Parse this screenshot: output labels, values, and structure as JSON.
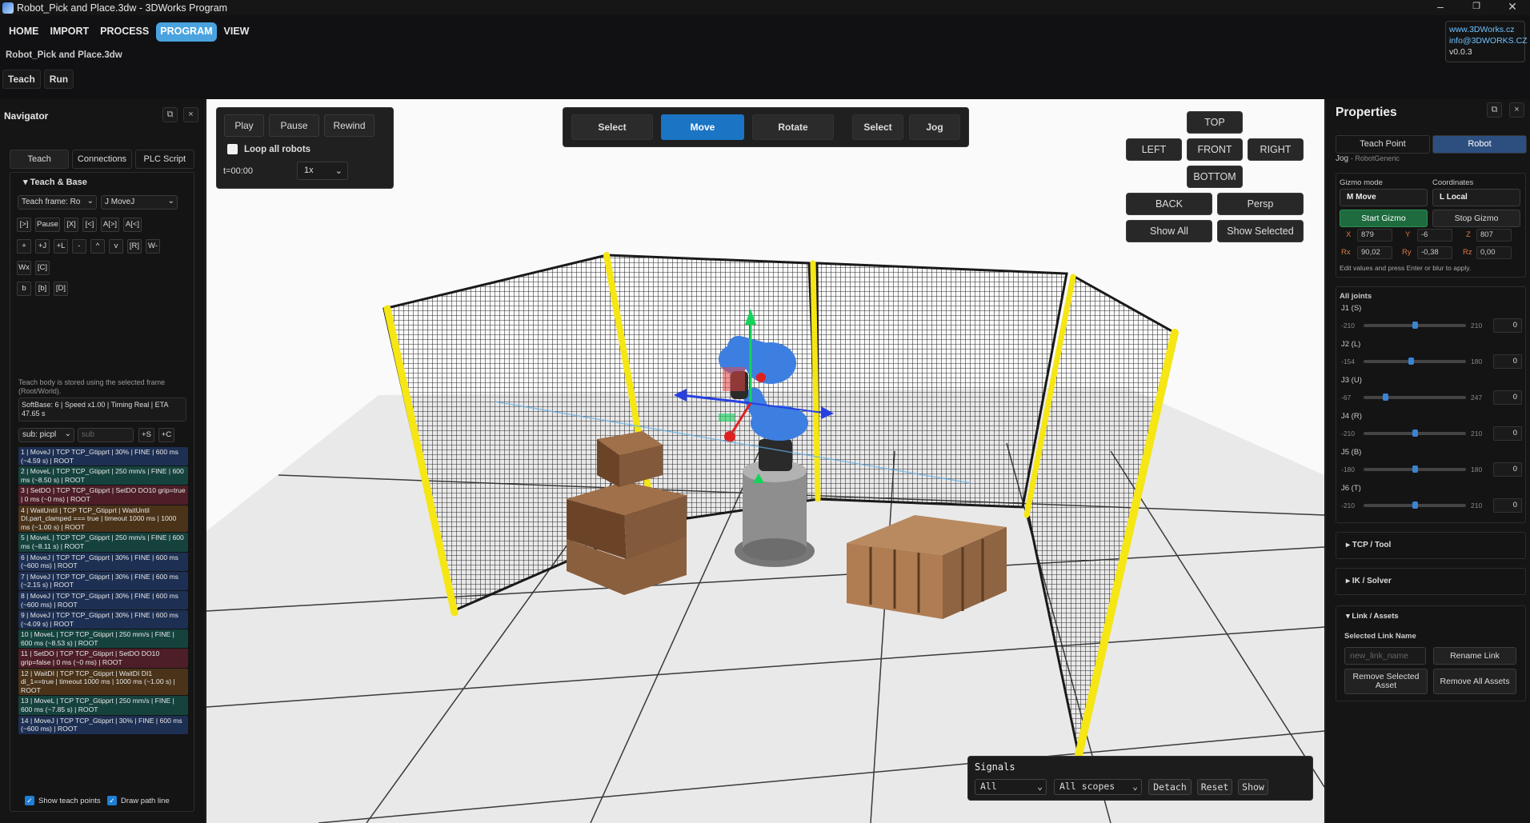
{
  "window": {
    "title": "Robot_Pick and Place.3dw - 3DWorks Program",
    "minimize": "–",
    "maximize": "❐",
    "close": "✕"
  },
  "menu": {
    "items": [
      "HOME",
      "IMPORT",
      "PROCESS",
      "PROGRAM",
      "VIEW"
    ],
    "active": "PROGRAM"
  },
  "file": {
    "name": "Robot_Pick and Place.3dw"
  },
  "modes": {
    "teach": "Teach",
    "run": "Run"
  },
  "about": {
    "site": "www.3DWorks.cz",
    "email": "info@3DWORKS.CZ",
    "version": "v0.0.3"
  },
  "navigator": {
    "title": "Navigator",
    "detach": "⧉",
    "close": "×",
    "tabs": [
      "Teach",
      "Connections",
      "PLC Script"
    ],
    "section": "▾  Teach & Base",
    "teach_frame": "Teach frame: Ro",
    "move_type": "J MoveJ",
    "tool_row1": [
      "[>]",
      "Pause",
      "[X]",
      "[<]",
      "A[>]",
      "A[<]"
    ],
    "tool_row2": [
      "+",
      "+J",
      "+L",
      "-",
      "^",
      "v",
      "[R]",
      "W-"
    ],
    "tool_row3": [
      "Wx",
      "[C]"
    ],
    "tool_row4": [
      "b",
      "[b]",
      "[D]"
    ],
    "note": "Teach body is stored using the selected frame (Root/World).",
    "info": "SoftBase: 6 | Speed x1.00 | Timing Real | ETA 47.65 s",
    "sub_select": "sub: picpl",
    "sub_placeholder": "sub",
    "add_s": "+S",
    "add_c": "+C",
    "steps": [
      {
        "text": "1 | MoveJ | TCP TCP_Gtipprt | 30% | FINE | 600 ms (~4.59 s) | ROOT",
        "kind": "movej"
      },
      {
        "text": "2 | MoveL | TCP TCP_Gtipprt | 250 mm/s | FINE | 600 ms (~8.50 s) | ROOT",
        "kind": "movel"
      },
      {
        "text": "3 | SetDO | TCP TCP_Gtipprt | SetDO DO10 grip=true | 0 ms (~0 ms) | ROOT",
        "kind": "setdo"
      },
      {
        "text": "4 | WaitUntil | TCP TCP_Gtipprt | WaitUntil DI.part_clamped === true | timeout 1000 ms | 1000 ms (~1.00 s) | ROOT",
        "kind": "wait"
      },
      {
        "text": "5 | MoveL | TCP TCP_Gtipprt | 250 mm/s | FINE | 600 ms (~8.11 s) | ROOT",
        "kind": "movel"
      },
      {
        "text": "6 | MoveJ | TCP TCP_Gtipprt | 30% | FINE | 600 ms (~600 ms) | ROOT",
        "kind": "movej"
      },
      {
        "text": "7 | MoveJ | TCP TCP_Gtipprt | 30% | FINE | 600 ms (~2.15 s) | ROOT",
        "kind": "movej"
      },
      {
        "text": "8 | MoveJ | TCP TCP_Gtipprt | 30% | FINE | 600 ms (~600 ms) | ROOT",
        "kind": "movej"
      },
      {
        "text": "9 | MoveJ | TCP TCP_Gtipprt | 30% | FINE | 600 ms (~4.09 s) | ROOT",
        "kind": "movej"
      },
      {
        "text": "10 | MoveL | TCP TCP_Gtipprt | 250 mm/s | FINE | 600 ms (~8.53 s) | ROOT",
        "kind": "movel"
      },
      {
        "text": "11 | SetDO | TCP TCP_Gtipprt | SetDO DO10 grip=false | 0 ms (~0 ms) | ROOT",
        "kind": "setdo"
      },
      {
        "text": "12 | WaitDI | TCP TCP_Gtipprt | WaitDI DI1 di_1==true | timeout 1000 ms | 1000 ms (~1.00 s) | ROOT",
        "kind": "wait"
      },
      {
        "text": "13 | MoveL | TCP TCP_Gtipprt | 250 mm/s | FINE | 600 ms (~7.85 s) | ROOT",
        "kind": "movel"
      },
      {
        "text": "14 | MoveJ | TCP TCP_Gtipprt | 30% | FINE | 600 ms (~600 ms) | ROOT",
        "kind": "movej"
      }
    ],
    "show_points": "Show teach points",
    "draw_path": "Draw path line"
  },
  "playback": {
    "play": "Play",
    "pause": "Pause",
    "rewind": "Rewind",
    "loop": "Loop all robots",
    "time": "t=00:00",
    "speed": "1x"
  },
  "tools": {
    "select": "Select",
    "move": "Move",
    "rotate": "Rotate",
    "select2": "Select",
    "jog": "Jog",
    "active": "Move"
  },
  "views": {
    "top": "TOP",
    "left": "LEFT",
    "front": "FRONT",
    "right": "RIGHT",
    "bottom": "BOTTOM",
    "back": "BACK",
    "persp": "Persp",
    "show_all": "Show All",
    "show_selected": "Show Selected"
  },
  "signals": {
    "title": "Signals",
    "filter": "All",
    "scope": "All scopes",
    "detach": "Detach",
    "reset": "Reset",
    "show": "Show"
  },
  "properties": {
    "title": "Properties",
    "detach": "⧉",
    "close": "×",
    "tabs": [
      "Teach Point",
      "Robot"
    ],
    "active_tab": "Robot",
    "jog_label": "Jog",
    "jog_robot": "- RobotGeneric",
    "gizmo_mode_label": "Gizmo mode",
    "gizmo_mode": "M Move",
    "coords_label": "Coordinates",
    "coords": "L Local",
    "start": "Start Gizmo",
    "stop": "Stop Gizmo",
    "x_label": "X",
    "x": "879",
    "y_label": "Y",
    "y": "-6",
    "z_label": "Z",
    "z": "807",
    "rx_label": "Rx",
    "rx": "90,02",
    "ry_label": "Ry",
    "ry": "-0,38",
    "rz_label": "Rz",
    "rz": "0,00",
    "edit_note": "Edit values and press Enter or blur to apply.",
    "joints_title": "All joints",
    "joints": [
      {
        "name": "J1 (S)",
        "min": "-210",
        "max": "210",
        "value": "0",
        "fraction": 0.5
      },
      {
        "name": "J2 (L)",
        "min": "-154",
        "max": "180",
        "value": "0",
        "fraction": 0.46
      },
      {
        "name": "J3 (U)",
        "min": "-67",
        "max": "247",
        "value": "0",
        "fraction": 0.21
      },
      {
        "name": "J4 (R)",
        "min": "-210",
        "max": "210",
        "value": "0",
        "fraction": 0.5
      },
      {
        "name": "J5 (B)",
        "min": "-180",
        "max": "180",
        "value": "0",
        "fraction": 0.5
      },
      {
        "name": "J6 (T)",
        "min": "-210",
        "max": "210",
        "value": "0",
        "fraction": 0.5
      }
    ],
    "tcp_section": "▸   TCP / Tool",
    "ik_section": "▸   IK / Solver",
    "link_section": "▾   Link / Assets",
    "link_name_label": "Selected Link Name",
    "link_placeholder": "new_link_name",
    "rename": "Rename Link",
    "remove_selected": "Remove Selected Asset",
    "remove_all": "Remove All Assets"
  },
  "colors": {
    "accent": "#1b74c4",
    "menu_active": "#4aa3df",
    "fence_post": "#f5e614",
    "robot": "#3d7fe0",
    "start_gizmo": "#1d6b3f"
  }
}
